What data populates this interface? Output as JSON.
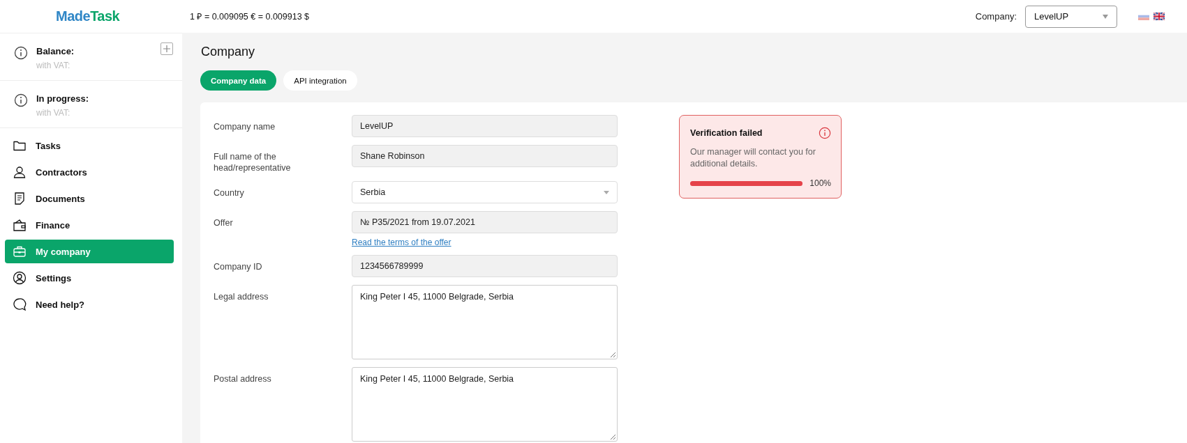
{
  "header": {
    "logo": {
      "part_1": "Made",
      "part_2": "Task"
    },
    "rate": "1 ₽ = 0.009095 € = 0.009913 $",
    "company_label": "Company:",
    "company_value": "LevelUP",
    "languages": [
      {
        "kind": "ru",
        "selected": false
      },
      {
        "kind": "en",
        "selected": true
      }
    ]
  },
  "sidebar": {
    "balances": [
      {
        "label": "Balance:",
        "sub": "with VAT:",
        "addable": true
      },
      {
        "label": "In progress:",
        "sub": "with VAT:",
        "addable": false
      }
    ],
    "items": [
      {
        "kind": "folder",
        "label": "Tasks",
        "selected": false
      },
      {
        "kind": "person",
        "label": "Contractors",
        "selected": false
      },
      {
        "kind": "document",
        "label": "Documents",
        "selected": false
      },
      {
        "kind": "wallet",
        "label": "Finance",
        "selected": false
      },
      {
        "kind": "briefcase",
        "label": "My company",
        "selected": true
      },
      {
        "kind": "profile",
        "label": "Settings",
        "selected": false
      },
      {
        "kind": "chat",
        "label": "Need help?",
        "selected": false
      }
    ]
  },
  "page": {
    "title": "Company",
    "tabs": [
      {
        "label": "Company data",
        "selected": true
      },
      {
        "label": "API integration",
        "selected": false
      }
    ],
    "fields": [
      {
        "kind": "text",
        "label": "Company name",
        "value": "LevelUP",
        "disabled": true
      },
      {
        "kind": "text",
        "label": "Full name of the head/representative",
        "value": "Shane Robinson",
        "disabled": true
      },
      {
        "kind": "select",
        "label": "Country",
        "value": "Serbia",
        "disabled": false
      },
      {
        "kind": "text",
        "label": "Offer",
        "value": "№ P35/2021 from 19.07.2021",
        "disabled": true,
        "link": "Read the terms of the offer"
      },
      {
        "kind": "text",
        "label": "Company ID",
        "value": "1234566789999",
        "disabled": true
      },
      {
        "kind": "textarea",
        "label": "Legal address",
        "value": "King Peter I 45, 11000 Belgrade, Serbia",
        "disabled": false
      },
      {
        "kind": "textarea",
        "label": "Postal address",
        "value": "King Peter I 45, 11000 Belgrade, Serbia",
        "disabled": false
      }
    ],
    "verification": {
      "title": "Verification failed",
      "text": "Our manager will contact you for additional details.",
      "level": 1,
      "reading": "100%"
    }
  }
}
